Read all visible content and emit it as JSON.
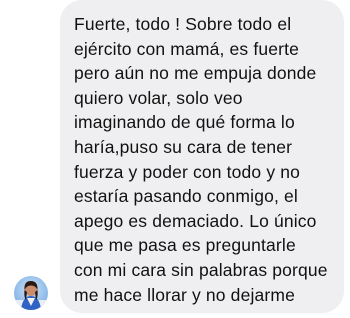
{
  "conversation": {
    "message": {
      "lines": [
        "Fuerte, todo ! Sobre todo el",
        "ejército con mamá, es fuerte",
        "pero aún no me empuja donde",
        "quiero volar, solo veo",
        "imaginando de qué forma lo",
        "haría,puso su cara de tener",
        "fuerza y poder con todo y no",
        "estaría pasando conmigo, el",
        "apego es demaciado. Lo único",
        "que me pasa es preguntarle",
        "con mi cara sin palabras porque",
        "me hace llorar y no dejarme"
      ]
    },
    "sender_avatar_icon": "profile-photo-avatar",
    "colors": {
      "bubble_background": "#efeff1",
      "text": "#111111"
    }
  }
}
